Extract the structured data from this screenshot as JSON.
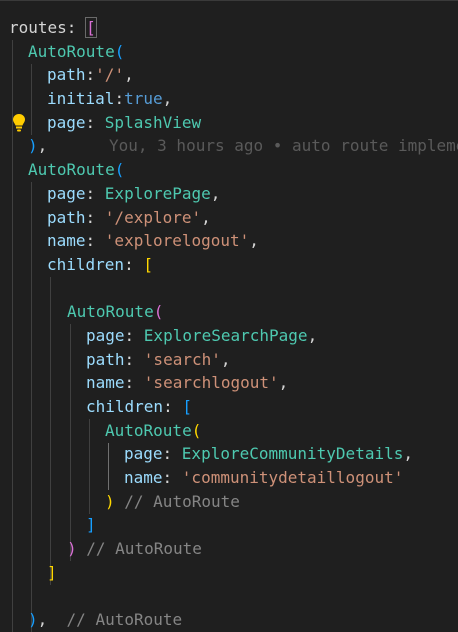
{
  "colors": {
    "background": "#1f1f1f",
    "property": "#9cdcfe",
    "type": "#4ec9b0",
    "string": "#ce9178",
    "keyword": "#569cd6",
    "comment": "#858585",
    "bracket_gold": "#ffd700",
    "bracket_orchid": "#da70d6",
    "bracket_blue": "#179fff"
  },
  "icons": {
    "lightbulb": "lightbulb-icon"
  },
  "blame": "You, 3 hours ago • auto route impleme",
  "code": {
    "l1": {
      "key": "routes",
      "colon": ": ",
      "open": "["
    },
    "l2": {
      "type": "AutoRoute",
      "open": "("
    },
    "l3": {
      "key": "path",
      "colon": ":",
      "val": "'/'",
      "tail": ","
    },
    "l4": {
      "key": "initial",
      "colon": ":",
      "val": "true",
      "tail": ","
    },
    "l5": {
      "key": "page",
      "colon": ": ",
      "val": "SplashView"
    },
    "l6": {
      "close": ")",
      "tail": ","
    },
    "l7": {
      "type": "AutoRoute",
      "open": "("
    },
    "l8": {
      "key": "page",
      "colon": ": ",
      "val": "ExplorePage",
      "tail": ","
    },
    "l9": {
      "key": "path",
      "colon": ": ",
      "val": "'/explore'",
      "tail": ","
    },
    "l10": {
      "key": "name",
      "colon": ": ",
      "val": "'explorelogout'",
      "tail": ","
    },
    "l11": {
      "key": "children",
      "colon": ": ",
      "open": "["
    },
    "l13": {
      "type": "AutoRoute",
      "open": "("
    },
    "l14": {
      "key": "page",
      "colon": ": ",
      "val": "ExploreSearchPage",
      "tail": ","
    },
    "l15": {
      "key": "path",
      "colon": ": ",
      "val": "'search'",
      "tail": ","
    },
    "l16": {
      "key": "name",
      "colon": ": ",
      "val": "'searchlogout'",
      "tail": ","
    },
    "l17": {
      "key": "children",
      "colon": ": ",
      "open": "["
    },
    "l18": {
      "type": "AutoRoute",
      "open": "("
    },
    "l19": {
      "key": "page",
      "colon": ": ",
      "val": "ExploreCommunityDetails",
      "tail": ","
    },
    "l20": {
      "key": "name",
      "colon": ": ",
      "val": "'communitydetaillogout'"
    },
    "l21": {
      "close": ")",
      "comment": " // AutoRoute"
    },
    "l22": {
      "close": "]"
    },
    "l23": {
      "close": ")",
      "comment": " // AutoRoute"
    },
    "l24": {
      "close": "]"
    },
    "l26": {
      "close": ")",
      "tail": ",",
      "comment": "  // AutoRoute"
    }
  }
}
